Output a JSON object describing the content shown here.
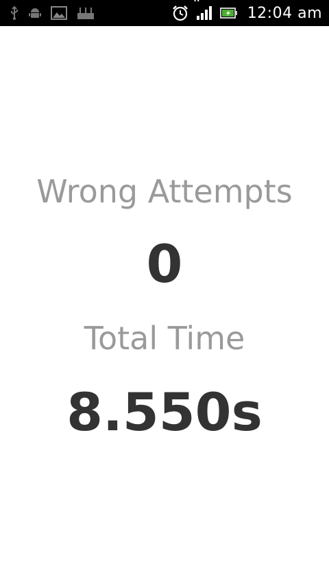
{
  "status_bar": {
    "time": "12:04 am",
    "icons_left": [
      "usb-icon",
      "android-debug-icon",
      "image-icon",
      "wifi-hotspot-icon"
    ],
    "icons_right": [
      "alarm-icon",
      "signal-h-icon",
      "battery-charging-icon"
    ],
    "network_type": "H"
  },
  "results": {
    "wrong_attempts_label": "Wrong Attempts",
    "wrong_attempts_value": "0",
    "total_time_label": "Total Time",
    "total_time_value": "8.550s"
  }
}
